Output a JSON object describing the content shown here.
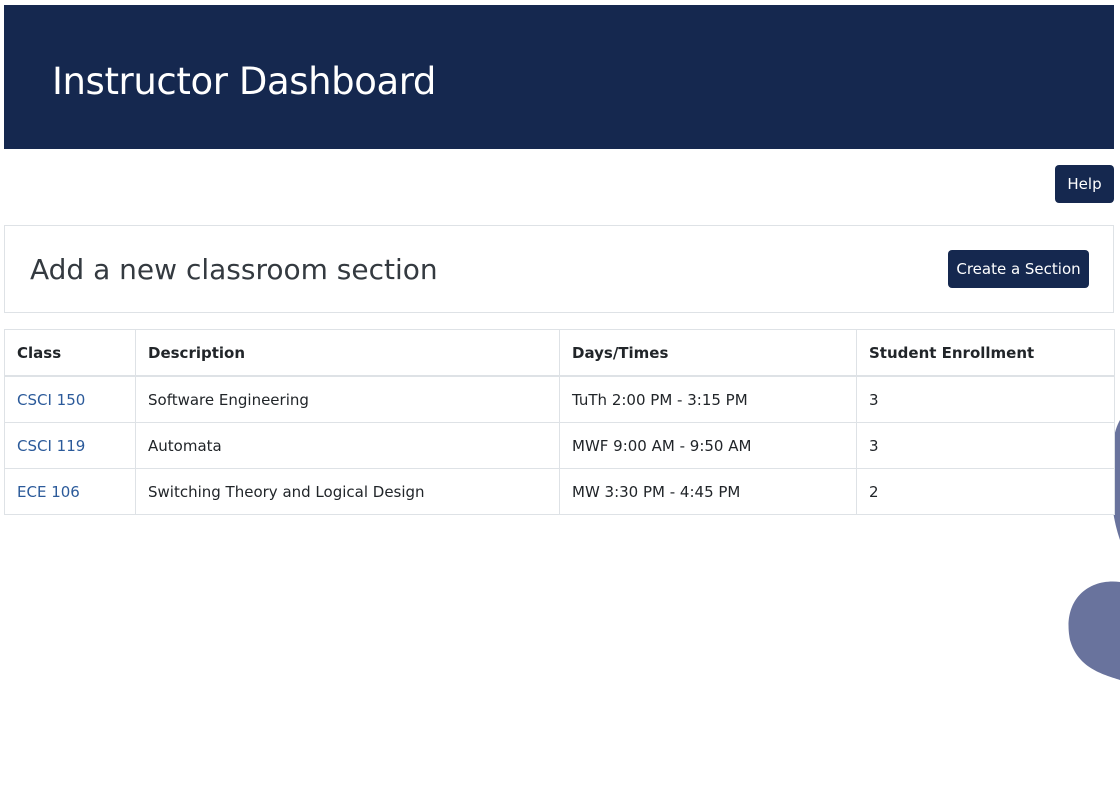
{
  "header": {
    "title": "Instructor Dashboard"
  },
  "help_button": {
    "label": "Help"
  },
  "new_section_card": {
    "title": "Add a new classroom section",
    "button_label": "Create a Section"
  },
  "sections_table": {
    "columns": [
      "Class",
      "Description",
      "Days/Times",
      "Student Enrollment"
    ],
    "rows": [
      {
        "class": "CSCI 150",
        "description": "Software Engineering",
        "days_times": "TuTh 2:00 PM - 3:15 PM",
        "enrollment": "3"
      },
      {
        "class": "CSCI 119",
        "description": "Automata",
        "days_times": "MWF 9:00 AM - 9:50 AM",
        "enrollment": "3"
      },
      {
        "class": "ECE 106",
        "description": "Switching Theory and Logical Design",
        "days_times": "MW 3:30 PM - 4:45 PM",
        "enrollment": "2"
      }
    ]
  },
  "colors": {
    "brand_navy": "#15284f",
    "link_blue": "#2b5a9a",
    "decor_blob": "#69739d"
  }
}
